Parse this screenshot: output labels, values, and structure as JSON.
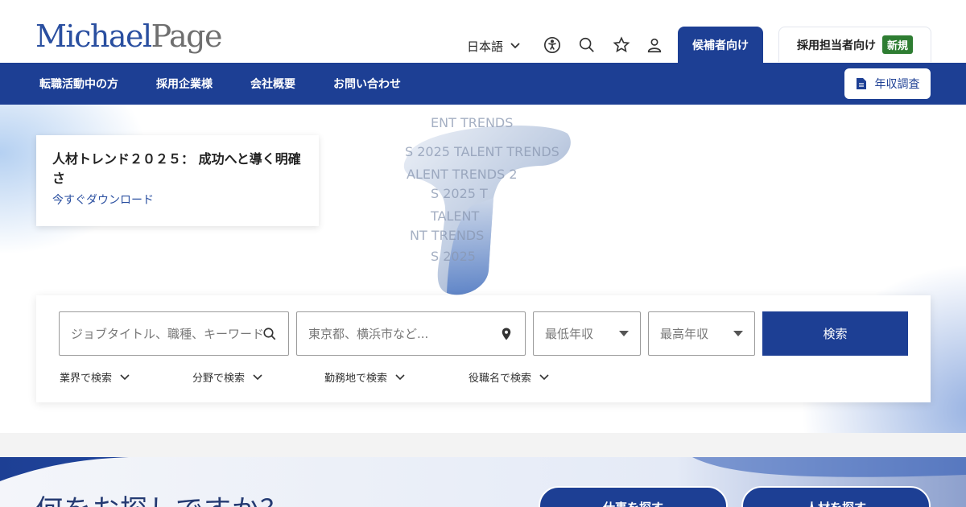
{
  "header": {
    "logo_part1": "Michael",
    "logo_part2": "Page",
    "language": "日本語",
    "icons": [
      "accessibility-icon",
      "search-icon",
      "star-icon",
      "user-icon"
    ],
    "tab_candidate": "候補者向け",
    "tab_employer": "採用担当者向け",
    "badge_new": "新規"
  },
  "nav": {
    "items": [
      "転職活動中の方",
      "採用企業様",
      "会社概要",
      "お問い合わせ"
    ],
    "salary_survey": "年収調査"
  },
  "hero": {
    "art_lines": [
      "ENT TRENDS",
      "S 2025 TALENT TRENDS",
      "ALENT TRENDS 2",
      "S 2025 T",
      "TALENT",
      "NT TRENDS",
      "S 2025"
    ],
    "promo_title": "人材トレンド２０２５： 成功へと導く明確さ",
    "promo_link": "今すぐダウンロード"
  },
  "search": {
    "keyword_placeholder": "ジョブタイトル、職種、キーワード",
    "location_placeholder": "東京都、横浜市など...",
    "min_salary": "最低年収",
    "max_salary": "最高年収",
    "search_button": "検索",
    "filters": [
      "業界で検索",
      "分野で検索",
      "勤務地で検索",
      "役職名で検索"
    ]
  },
  "bottom": {
    "title": "何をお探しですか？",
    "find_job": "仕事を探す",
    "find_talent": "人材を探す"
  },
  "colors": {
    "primary": "#1d3f94",
    "logo_blue": "#2a4fa0",
    "logo_gray": "#6f6f6f",
    "badge_green": "#2e7d32"
  }
}
